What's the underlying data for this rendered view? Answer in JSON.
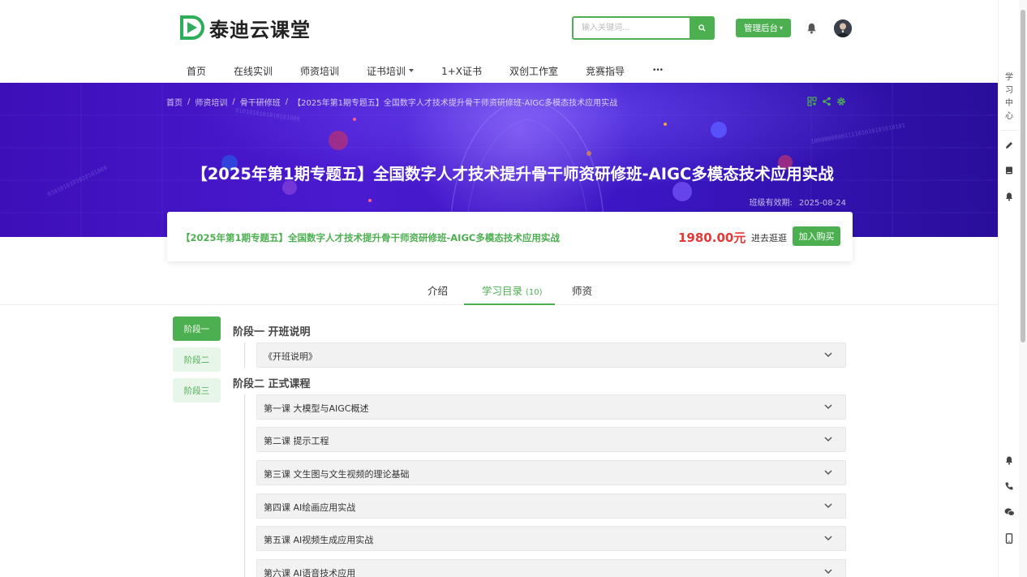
{
  "brand": {
    "name": "泰迪云课堂",
    "color": "#4caf50"
  },
  "search": {
    "placeholder": "输入关键词...",
    "icon": "search-icon"
  },
  "header": {
    "admin_label": "管理后台"
  },
  "nav": [
    {
      "label": "首页",
      "dropdown": false
    },
    {
      "label": "在线实训",
      "dropdown": false
    },
    {
      "label": "师资培训",
      "dropdown": false
    },
    {
      "label": "证书培训",
      "dropdown": true
    },
    {
      "label": "1+X证书",
      "dropdown": false
    },
    {
      "label": "双创工作室",
      "dropdown": false
    },
    {
      "label": "竞赛指导",
      "dropdown": false
    },
    {
      "label": "•••",
      "dropdown": false
    }
  ],
  "breadcrumb": [
    "首页",
    "师资培训",
    "骨干研修班",
    "【2025年第1期专题五】全国数字人才技术提升骨干师资研修班-AIGC多模态技术应用实战"
  ],
  "banner": {
    "title": "【2025年第1期专题五】全国数字人才技术提升骨干师资研修班-AIGC多模态技术应用实战",
    "validity_label": "班级有效期:",
    "validity_date": "2025-08-24"
  },
  "purchase": {
    "title": "【2025年第1期专题五】全国数字人才技术提升骨干师资研修班-AIGC多模态技术应用实战",
    "price": "1980.00元",
    "visit_label": "进去逛逛",
    "buy_label": "加入购买",
    "price_color": "#e53935"
  },
  "tabs": [
    {
      "label": "介绍",
      "count": ""
    },
    {
      "label": "学习目录",
      "count": "(10)"
    },
    {
      "label": "师资",
      "count": ""
    }
  ],
  "active_tab": 1,
  "stages_nav": [
    "阶段一",
    "阶段二",
    "阶段三"
  ],
  "active_stage": 0,
  "sections": [
    {
      "title": "阶段一 开班说明",
      "lessons": [
        "《开班说明》"
      ]
    },
    {
      "title": "阶段二 正式课程",
      "lessons": [
        "第一课 大模型与AIGC概述",
        "第二课 提示工程",
        "第三课 文生图与文生视频的理论基础",
        "第四课 AI绘画应用实战",
        "第五课 AI视频生成应用实战",
        "第六课 AI语音技术应用"
      ]
    }
  ],
  "right_sidebar": {
    "learning_center": "学习中心",
    "icons": [
      "pencil-icon",
      "book-icon",
      "bell-icon",
      "notification-icon",
      "phone-icon",
      "wechat-icon",
      "mobile-icon"
    ]
  }
}
